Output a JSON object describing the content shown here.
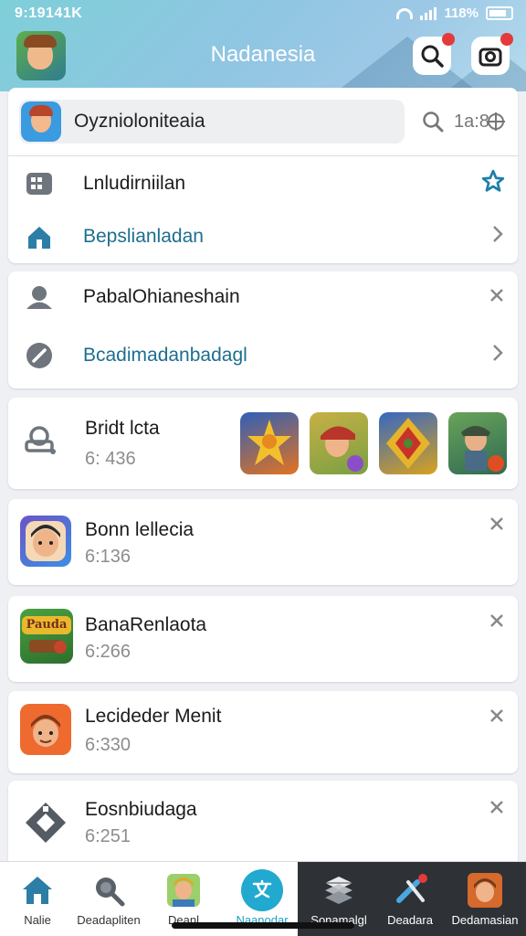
{
  "status_bar": {
    "time": "9:19141K",
    "battery": "118%"
  },
  "header": {
    "title": "Nadanesia"
  },
  "search": {
    "text": "Oyznioloniteaia",
    "tail": "1a:8"
  },
  "menu1": {
    "items": [
      {
        "label": "Lnludirniilan",
        "icon": "grid-icon",
        "tail": "star-icon"
      },
      {
        "label": "Bepslianladan",
        "icon": "house-icon",
        "tail": "chevron-right-icon"
      }
    ]
  },
  "menu2": {
    "items": [
      {
        "label": "PabalOhianeshain",
        "icon": "user-icon",
        "tail": "close-icon"
      },
      {
        "label": "Bcadimadanbadagl",
        "icon": "edit-icon",
        "tail": "chevron-right-icon"
      }
    ]
  },
  "featured": {
    "title": "Bridt lcta",
    "sub": "6: 436"
  },
  "games": [
    {
      "title": "Bonn lellecia",
      "sub": "6:136"
    },
    {
      "title": "BanaRenlaota",
      "sub": "6:266",
      "thumb_text": "Pauda"
    },
    {
      "title": "Lecideder Menit",
      "sub": "6:330"
    },
    {
      "title": "Eosnbiudaga",
      "sub": "6:251"
    }
  ],
  "nav": [
    {
      "label": "Nalie",
      "icon": "home-icon"
    },
    {
      "label": "Deadapliten",
      "icon": "search-icon"
    },
    {
      "label": "Deanl",
      "icon": "character-icon"
    },
    {
      "label": "Naanodar",
      "icon": "translate-icon"
    },
    {
      "label": "Sonamalgl",
      "icon": "layers-icon"
    },
    {
      "label": "Deadara",
      "icon": "pen-icon"
    },
    {
      "label": "Dedamasian",
      "icon": "game-icon"
    }
  ],
  "colors": {
    "accent": "#1e9fc3",
    "link": "#1d6e8f",
    "badge": "#e53a3a",
    "dark_nav": "#2e3136"
  }
}
